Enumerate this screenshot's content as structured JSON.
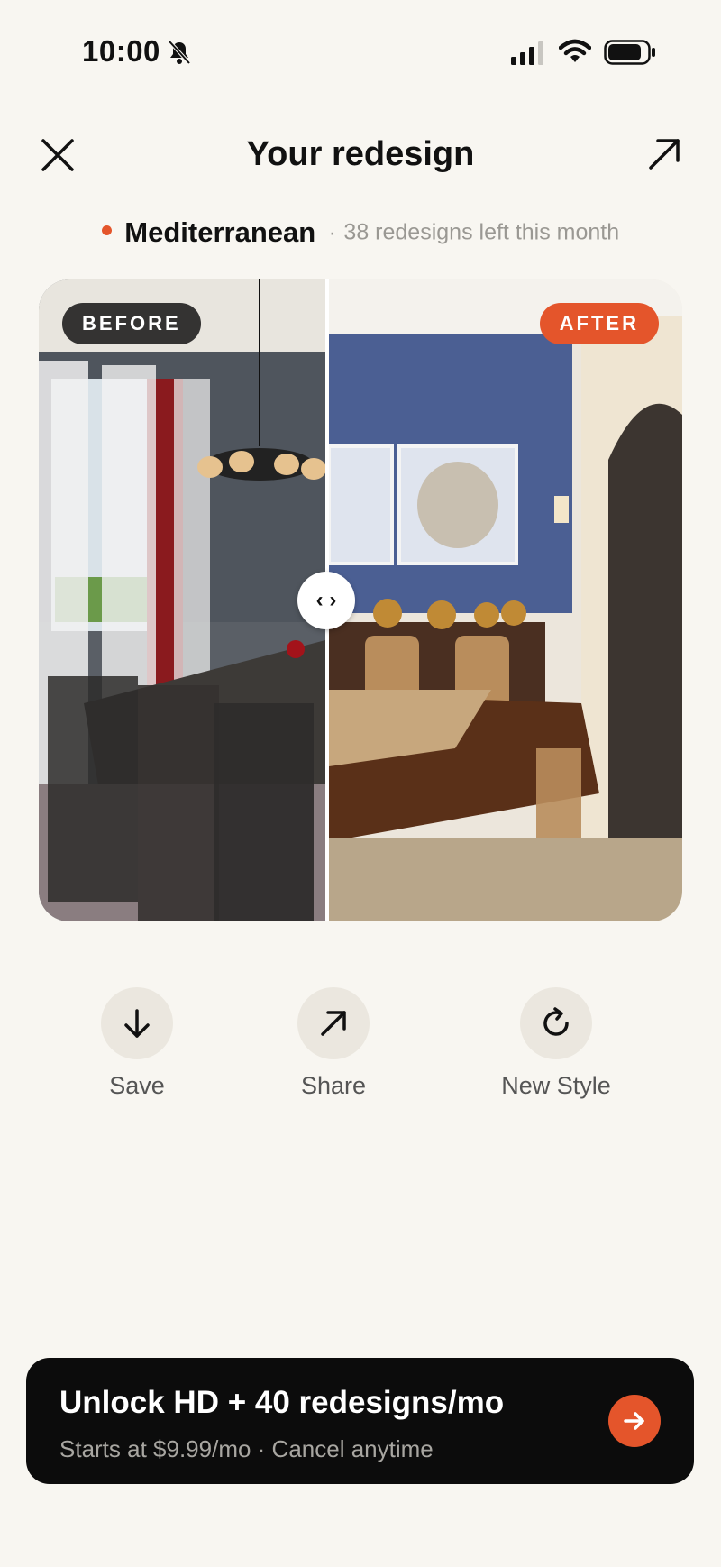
{
  "status_bar": {
    "time": "10:00"
  },
  "header": {
    "title": "Your redesign"
  },
  "style_info": {
    "style": "Mediterranean",
    "separator": "·",
    "remaining": "38 redesigns left this month"
  },
  "compare": {
    "before_label": "BEFORE",
    "after_label": "AFTER",
    "handle": "‹ ›"
  },
  "actions": [
    {
      "label": "Save",
      "icon": "download-icon"
    },
    {
      "label": "Share",
      "icon": "share-arrow-icon"
    },
    {
      "label": "New Style",
      "icon": "refresh-icon"
    }
  ],
  "cta": {
    "title": "Unlock HD + 40 redesigns/mo",
    "subtitle": "Starts at $9.99/mo · Cancel anytime"
  },
  "colors": {
    "accent": "#e4552b",
    "background": "#f8f6f1",
    "cta_bg": "#0c0c0c"
  }
}
